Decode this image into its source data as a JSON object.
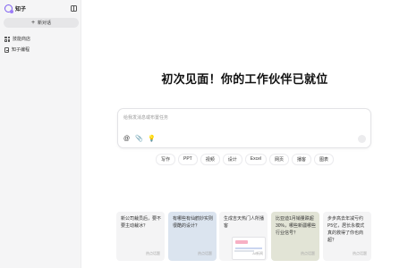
{
  "sidebar": {
    "brand": "知子",
    "new_chat_label": "新对话",
    "items": [
      {
        "label": "技能商店",
        "icon": "grid-icon"
      },
      {
        "label": "知子编程",
        "icon": "document-icon"
      }
    ]
  },
  "main": {
    "headline": "初次见面！你的工作伙伴已就位",
    "input": {
      "placeholder": "给我发消息或布置任务"
    },
    "chips": [
      "写作",
      "PPT",
      "视频",
      "设计",
      "Excel",
      "网页",
      "播客",
      "图表"
    ],
    "cards": [
      {
        "text": "新公司裁员后，要不要主动裁冰？",
        "tag": "热点话题"
      },
      {
        "text": "有哪些有仙鹤妙实则很酷的设计？",
        "tag": "热点话题"
      },
      {
        "text": "生成吉天热门人所播客",
        "tag": "AI新闻"
      },
      {
        "text": "比亚迪1月销量跌超30%，哪些新疆哪些行业信号？",
        "tag": "热点话题"
      },
      {
        "text": "步步高去年减亏约P5亿，居长永模式真的救得了你也商超？",
        "tag": "热点话题"
      }
    ]
  }
}
